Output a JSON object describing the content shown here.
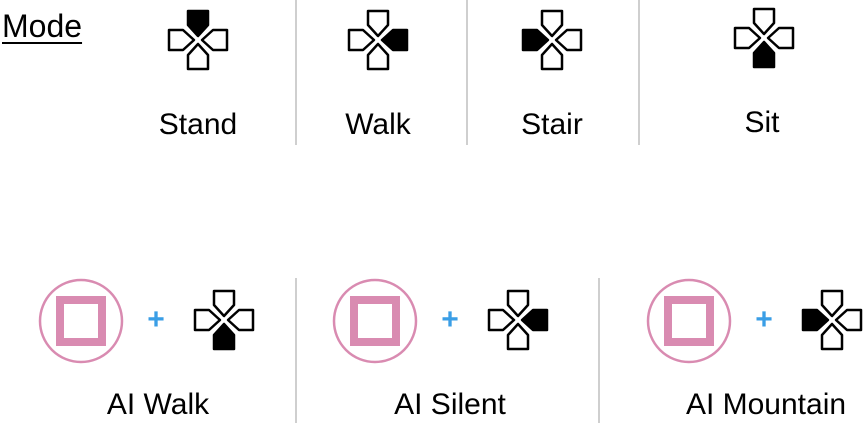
{
  "mode_label": "Mode",
  "colors": {
    "active": "#000000",
    "outline": "#000000",
    "plus": "#3a9ee6",
    "square_button": "#d98bb1"
  },
  "mode_items": [
    {
      "label": "Stand",
      "icon": "dpad-up-icon",
      "active_direction": "up"
    },
    {
      "label": "Walk",
      "icon": "dpad-right-icon",
      "active_direction": "right"
    },
    {
      "label": "Stair",
      "icon": "dpad-left-icon",
      "active_direction": "left"
    },
    {
      "label": "Sit",
      "icon": "dpad-down-icon",
      "active_direction": "down"
    }
  ],
  "plus_symbol": "+",
  "ai_items": [
    {
      "label": "AI Walk",
      "icon": "square-button-icon",
      "dpad_icon": "dpad-down-icon",
      "active_direction": "down"
    },
    {
      "label": "AI Silent",
      "icon": "square-button-icon",
      "dpad_icon": "dpad-right-icon",
      "active_direction": "right"
    },
    {
      "label": "AI Mountain",
      "icon": "square-button-icon",
      "dpad_icon": "dpad-left-icon",
      "active_direction": "left"
    }
  ]
}
